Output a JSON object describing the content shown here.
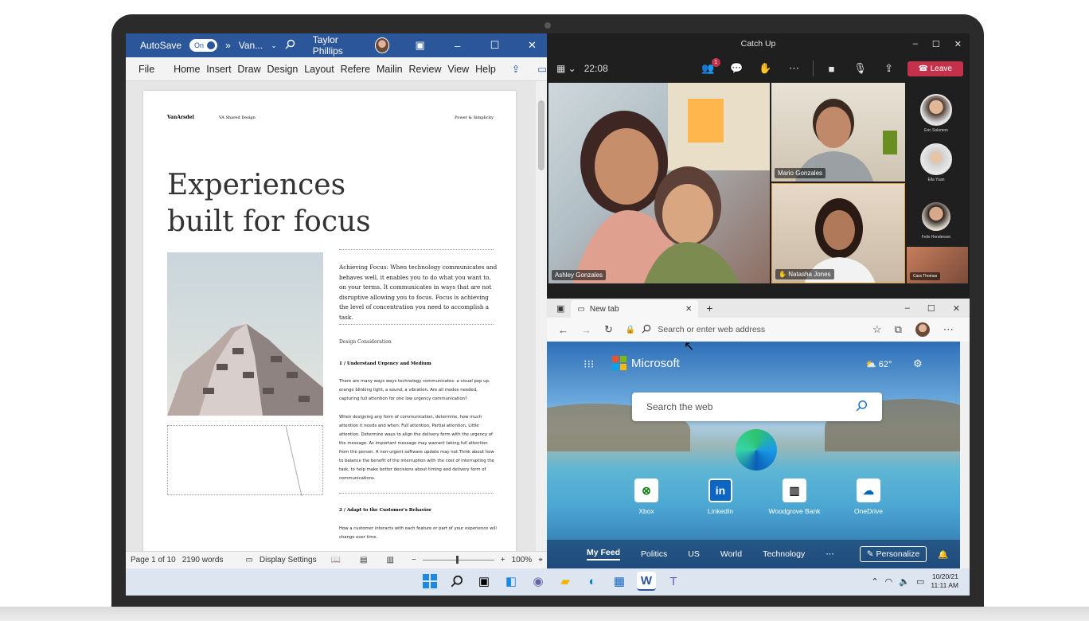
{
  "word": {
    "autosave": "AutoSave",
    "toggle": "On",
    "doc_name": "Van...",
    "user": "Taylor Phillips",
    "ribbon_tabs": [
      "File",
      "Home",
      "Insert",
      "Draw",
      "Design",
      "Layout",
      "Refere",
      "Mailin",
      "Review",
      "View",
      "Help"
    ],
    "page": {
      "brand": "VanArsdel",
      "series": "VA Shared Design",
      "tagline": "Power & Simplicity",
      "title_line1": "Experiences",
      "title_line2": "built for focus",
      "intro": "Achieving Focus: When technology communicates and behaves well, it enables you to do what you want to, on your terms. It communicates in ways that are not disruptive allowing you to focus. Focus is achieving the level of concentration you need to accomplish a task.",
      "section": "Design Consideration",
      "h1": "1 / Understand Urgency and Medium",
      "p1": "There are many ways ways technology communicates: a visual pop up, orange blinking light, a sound, a vibration. Are all modes needed, capturing full attention for one low urgency communication?",
      "p2": "When designing any form of communication, determine, how much attention it needs and when: Full attention, Partial attention, Little attention. Determine ways to align the delivery form with the urgency of the message. As important message may warrant taking full attention from the person. A non-urgent software update may not.Think about how to balance the benefit of the interruption with the cost of interrupting the task, to help make better decisions about timing and delivery form of communications.",
      "h2": "2 / Adapt to the Customer's Behavior",
      "p3": "How a customer interacts with each feature or part of your experience will change over time."
    },
    "status": {
      "page": "Page 1 of 10",
      "words": "2190 words",
      "display": "Display Settings",
      "zoom": "100%"
    }
  },
  "teams": {
    "title": "Catch Up",
    "timer": "22:08",
    "badge": "1",
    "leave": "Leave",
    "participants": {
      "main": "Ashley Gonzales",
      "top_right": "Mario Gonzales",
      "bottom_right": "Natasha Jones",
      "side": [
        "Eric Solomon",
        "Ella Yuan",
        "Felix Henderson",
        "Cara Thomas"
      ]
    }
  },
  "edge": {
    "tab": "New tab",
    "address_placeholder": "Search or enter web address",
    "brand": "Microsoft",
    "weather": "62°",
    "search_placeholder": "Search the web",
    "quick_links": [
      "Xbox",
      "LinkedIn",
      "Woodgrove Bank",
      "OneDrive"
    ],
    "feed": [
      "My Feed",
      "Politics",
      "US",
      "World",
      "Technology"
    ],
    "personalize": "Personalize"
  },
  "taskbar": {
    "date": "10/20/21",
    "time": "11:11 AM"
  },
  "colors": {
    "word_blue": "#2b579a",
    "teams_dark": "#201f1f",
    "leave_red": "#c4314b"
  }
}
